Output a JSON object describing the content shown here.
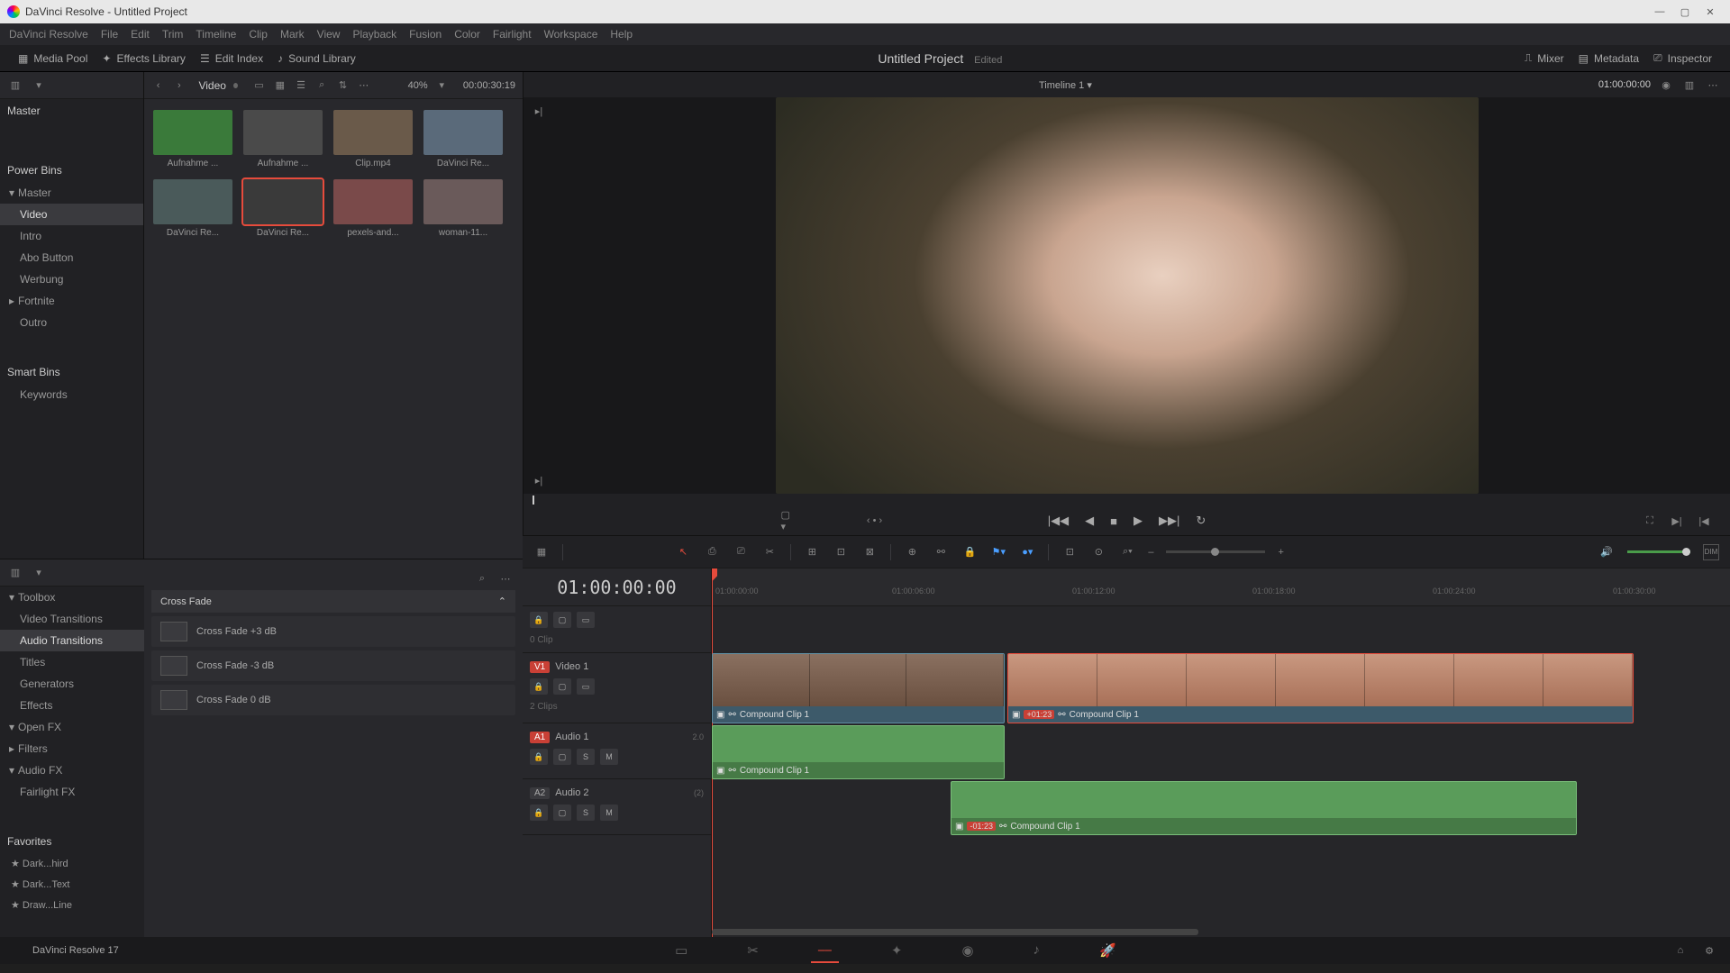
{
  "app": {
    "title": "DaVinci Resolve - Untitled Project"
  },
  "menu": [
    "DaVinci Resolve",
    "File",
    "Edit",
    "Trim",
    "Timeline",
    "Clip",
    "Mark",
    "View",
    "Playback",
    "Fusion",
    "Color",
    "Fairlight",
    "Workspace",
    "Help"
  ],
  "toolbar": {
    "media_pool": "Media Pool",
    "effects_library": "Effects Library",
    "edit_index": "Edit Index",
    "sound_library": "Sound Library",
    "project_name": "Untitled Project",
    "edited": "Edited",
    "mixer": "Mixer",
    "metadata": "Metadata",
    "inspector": "Inspector"
  },
  "pool_header": {
    "breadcrumb": "Video",
    "zoom": "40%",
    "tc": "00:00:30:19"
  },
  "sidebar": {
    "master": "Master",
    "power_bins": "Power Bins",
    "items": [
      "Master",
      "Video",
      "Intro",
      "Abo Button",
      "Werbung",
      "Fortnite",
      "Outro"
    ],
    "smart_bins": "Smart Bins",
    "keywords": "Keywords"
  },
  "clips": [
    {
      "name": "Aufnahme ...",
      "bg": "#3a7a3a"
    },
    {
      "name": "Aufnahme ...",
      "bg": "#4a4a4a"
    },
    {
      "name": "Clip.mp4",
      "bg": "#6a5a4a"
    },
    {
      "name": "DaVinci Re...",
      "bg": "#5a6a7a"
    },
    {
      "name": "DaVinci Re...",
      "bg": "#4a5a5a"
    },
    {
      "name": "DaVinci Re...",
      "bg": "#3a3a3a",
      "sel": true
    },
    {
      "name": "pexels-and...",
      "bg": "#7a4a4a"
    },
    {
      "name": "woman-11...",
      "bg": "#6a5a5a"
    }
  ],
  "viewer": {
    "timeline_name": "Timeline 1",
    "tc": "01:00:00:00"
  },
  "toolbox": {
    "header": "Toolbox",
    "items": [
      "Video Transitions",
      "Audio Transitions",
      "Titles",
      "Generators",
      "Effects"
    ],
    "openfx": "Open FX",
    "filters": "Filters",
    "audiofx": "Audio FX",
    "fairlight": "Fairlight FX",
    "favorites": "Favorites",
    "fav_items": [
      "Dark...hird",
      "Dark...Text",
      "Draw...Line"
    ]
  },
  "effects": {
    "group": "Cross Fade",
    "list": [
      "Cross Fade +3 dB",
      "Cross Fade -3 dB",
      "Cross Fade 0 dB"
    ]
  },
  "timeline": {
    "tc": "01:00:00:00",
    "ticks": [
      "01:00:00:00",
      "01:00:06:00",
      "01:00:12:00",
      "01:00:18:00",
      "01:00:24:00",
      "01:00:30:00"
    ],
    "v1": {
      "badge": "V1",
      "name": "Video 1",
      "clips_label": "2 Clips",
      "zero": "0 Clip"
    },
    "a1": {
      "badge": "A1",
      "name": "Audio 1",
      "meta": "2.0"
    },
    "a2": {
      "badge": "A2",
      "name": "Audio 2",
      "meta": "(2)"
    },
    "clip1": {
      "name": "Compound Clip 1"
    },
    "clip2": {
      "name": "Compound Clip 1",
      "off": "+01:23"
    },
    "aclip1": {
      "name": "Compound Clip 1"
    },
    "aclip2": {
      "name": "Compound Clip 1",
      "off": "-01:23"
    }
  },
  "footer": {
    "version": "DaVinci Resolve 17"
  }
}
